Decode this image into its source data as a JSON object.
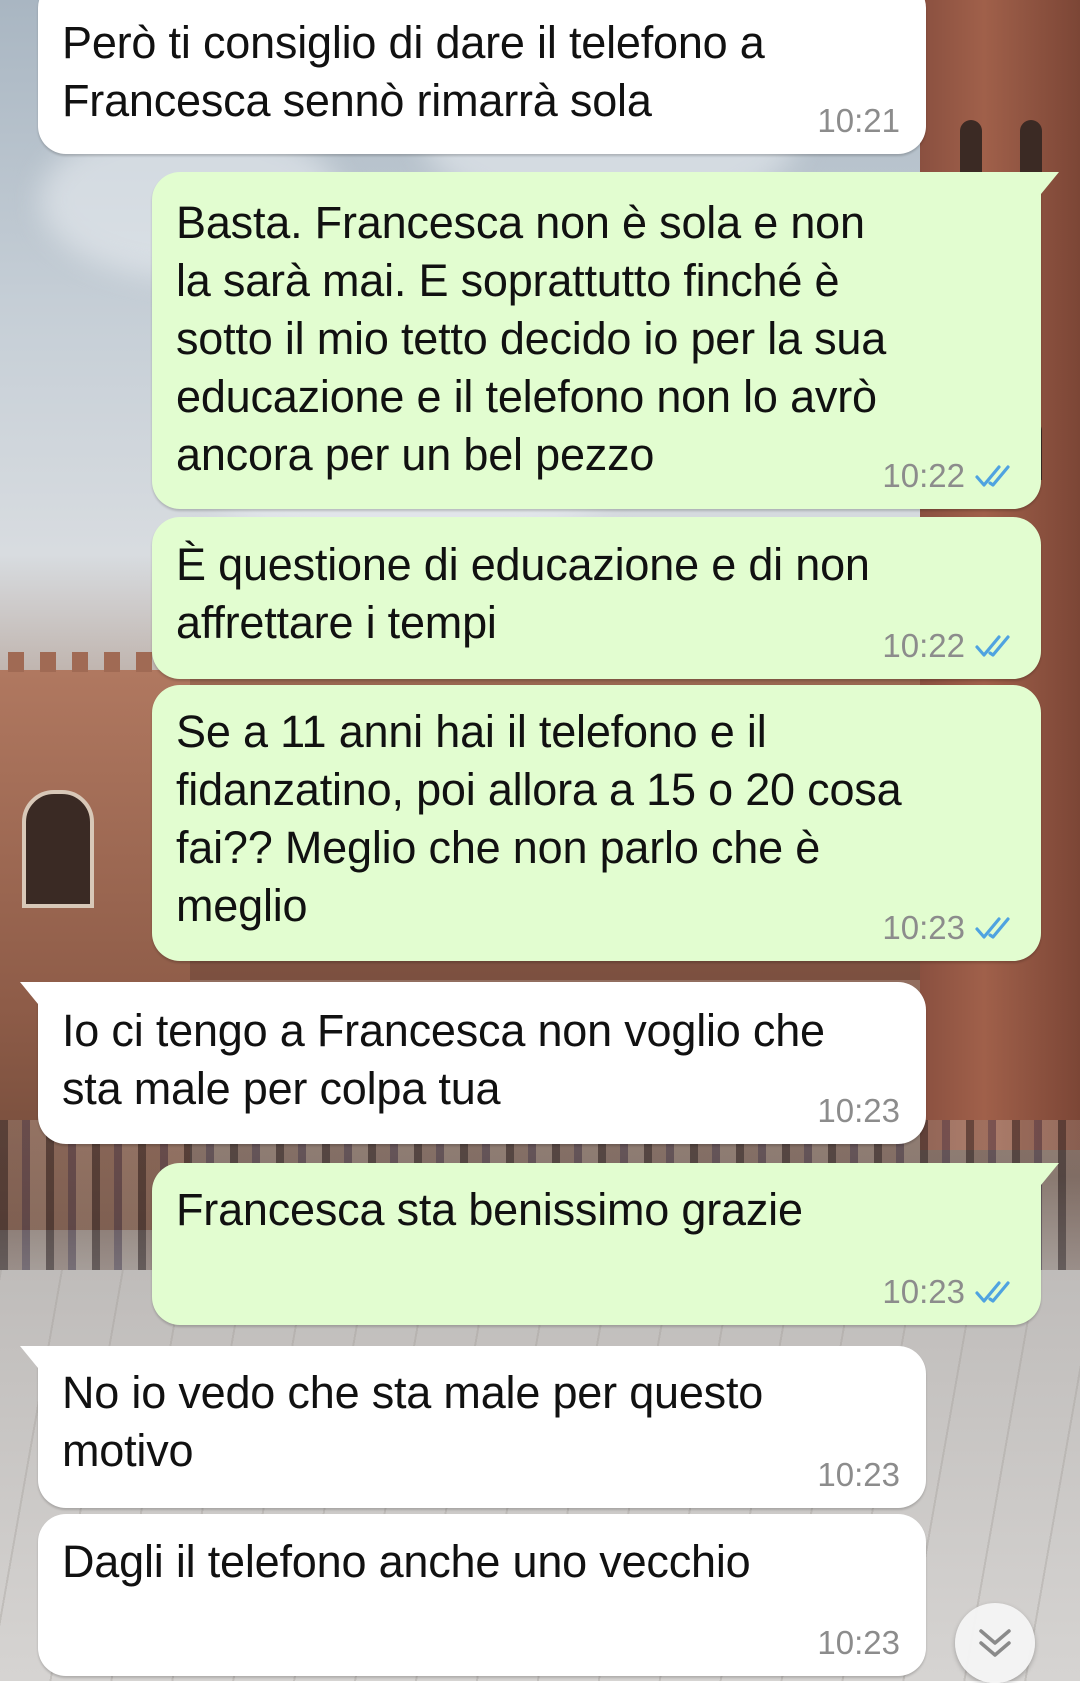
{
  "messages": [
    {
      "direction": "incoming",
      "text": "Però ti consiglio di dare il telefono a\nFrancesca sennò rimarrà sola",
      "time": "10:21"
    },
    {
      "direction": "outgoing",
      "text": "Basta. Francesca non è sola e non\nla sarà mai. E soprattutto finché è\nsotto il mio tetto decido io per la sua\neducazione e il telefono non lo avrò\nancora per un bel pezzo",
      "time": "10:22",
      "status": "read"
    },
    {
      "direction": "outgoing",
      "text": "È questione di educazione e di non\naffrettare i tempi",
      "time": "10:22",
      "status": "read"
    },
    {
      "direction": "outgoing",
      "text": "Se a 11 anni hai il telefono e il\nfidanzatino, poi allora a 15 o 20 cosa\nfai?? Meglio che non parlo che è\nmeglio",
      "time": "10:23",
      "status": "read"
    },
    {
      "direction": "incoming",
      "text": "Io ci tengo a Francesca non voglio che\nsta male per colpa tua",
      "time": "10:23"
    },
    {
      "direction": "outgoing",
      "text": "Francesca sta benissimo grazie",
      "time": "10:23",
      "status": "read"
    },
    {
      "direction": "incoming",
      "text": "No io vedo che sta male per questo\nmotivo",
      "time": "10:23"
    },
    {
      "direction": "incoming",
      "text": "Dagli il telefono anche uno vecchio",
      "time": "10:23"
    }
  ],
  "colors": {
    "incoming_bubble": "#ffffff",
    "outgoing_bubble": "#e2fdd0",
    "read_ticks": "#4fa3e0",
    "timestamp": "#8c8c8c"
  },
  "icons": {
    "read_receipt": "double-check-icon",
    "scroll_down": "chevron-down-icon"
  }
}
